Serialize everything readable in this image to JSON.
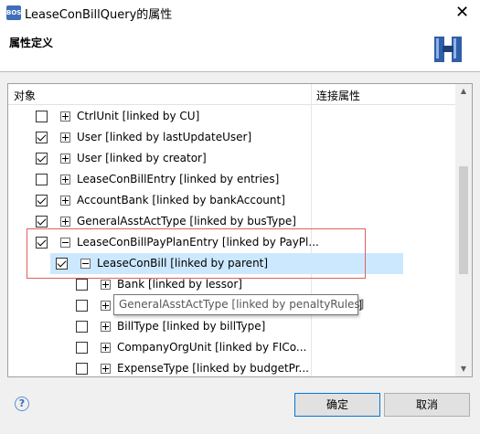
{
  "window": {
    "title": "LeaseConBillQuery的属性",
    "icon_text": "BOS"
  },
  "header": {
    "title": "属性定义"
  },
  "tree": {
    "columns": {
      "object": "对象",
      "link": "连接属性"
    },
    "rows": [
      {
        "label": "CtrlUnit [linked by CU]",
        "checked": false,
        "expander": "plus"
      },
      {
        "label": "User [linked by lastUpdateUser]",
        "checked": true,
        "expander": "plus"
      },
      {
        "label": "User [linked by creator]",
        "checked": true,
        "expander": "plus"
      },
      {
        "label": "LeaseConBillEntry [linked by entries]",
        "checked": false,
        "expander": "plus"
      },
      {
        "label": "AccountBank [linked by bankAccount]",
        "checked": true,
        "expander": "plus"
      },
      {
        "label": "GeneralAsstActType [linked by busType]",
        "checked": true,
        "expander": "plus"
      },
      {
        "label": "LeaseConBillPayPlanEntry [linked by PayPl...",
        "checked": true,
        "expander": "minus"
      },
      {
        "label": "LeaseConBill [linked by parent]",
        "checked": true,
        "expander": "minus",
        "selected": true
      },
      {
        "label": "Bank [linked by lessor]",
        "checked": false,
        "expander": "plus"
      },
      {
        "label": "GeneralAsstActType [linked by penaltyRules]",
        "checked": false,
        "expander": "plus"
      },
      {
        "label": "BillType [linked by billType]",
        "checked": false,
        "expander": "plus"
      },
      {
        "label": "CompanyOrgUnit [linked by FICo...",
        "checked": false,
        "expander": "plus"
      },
      {
        "label": "ExpenseType [linked by budgetPr...",
        "checked": false,
        "expander": "plus"
      }
    ]
  },
  "tooltip": {
    "text": "GeneralAsstActType [linked by penaltyRules]"
  },
  "footer": {
    "ok_label": "确定",
    "cancel_label": "取消",
    "help_icon": "?"
  },
  "colors": {
    "selection": "#cce8ff",
    "highlight_border": "#e06060",
    "ok_border": "#0078d7"
  },
  "icons": {
    "app": "bos-app-icon",
    "header": "binoculars-icon",
    "help": "help-icon",
    "close": "close-icon"
  }
}
